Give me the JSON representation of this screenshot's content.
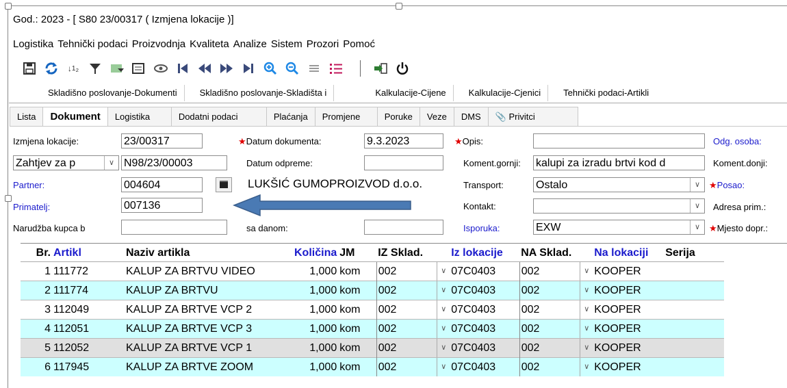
{
  "window": {
    "title": "God.: 2023 - [ S80 23/00317  ( Izmjena lokacije )]"
  },
  "menu": [
    "Logistika",
    "Tehnički podaci",
    "Proizvodnja",
    "Kvaliteta",
    "Analize",
    "Sistem",
    "Prozori",
    "Pomoć"
  ],
  "toolbar": {
    "icons": [
      "save-icon",
      "refresh-icon",
      "sort-icon",
      "filter-icon",
      "filter-table-icon",
      "preview-icon",
      "eye-icon",
      "first-icon",
      "prev-icon",
      "next-icon",
      "last-icon",
      "zoom-in-icon",
      "zoom-out-icon",
      "align-icon",
      "list-icon",
      "exit-icon",
      "power-icon"
    ]
  },
  "window_tabs": [
    "Skladišno poslovanje-Dokumenti",
    "Skladišno poslovanje-Skladišta i",
    "Kalkulacije-Cijene",
    "Kalkulacije-Cjenici",
    "Tehnički podaci-Artikli"
  ],
  "doc_tabs": [
    "Lista",
    "Dokument",
    "Logistika",
    "Dodatni podaci",
    "Plaćanja",
    "Promjene",
    "Poruke",
    "Veze",
    "DMS",
    "Privitci"
  ],
  "form": {
    "izmjena_label": "Izmjena lokacije:",
    "izmjena_value": "23/00317",
    "datum_dok_label": "Datum dokumenta:",
    "datum_dok_value": "9.3.2023",
    "opis_label": "Opis:",
    "odg_osoba_label": "Odg. osoba:",
    "zahtjev_select": "Zahtjev za p",
    "zahtjev_value": "N98/23/00003",
    "datum_odp_label": "Datum odpreme:",
    "koment_gornji_label": "Koment.gornji:",
    "koment_gornji_value": "kalupi za izradu brtvi kod d",
    "koment_donji_label": "Koment.donji:",
    "partner_label": "Partner:",
    "partner_value": "004604",
    "partner_name": "LUKŠIĆ GUMOPROIZVOD d.o.o.",
    "transport_label": "Transport:",
    "transport_value": "Ostalo",
    "posao_label": "Posao:",
    "primatelj_label": "Primatelj:",
    "primatelj_value": "007136",
    "kontakt_label": "Kontakt:",
    "adresa_label": "Adresa prim.:",
    "narudzba_label": "Narudžba kupca b",
    "sa_danom_label": "sa danom:",
    "isporuka_label": "Isporuka:",
    "isporuka_value": "EXW",
    "mjesto_label": "Mjesto dopr.:"
  },
  "grid": {
    "headers": {
      "br": "Br.",
      "artikl": "Artikl",
      "naziv": "Naziv artikla",
      "kolicina": "Količina",
      "jm": "JM",
      "iz_sklad": "IZ Sklad.",
      "iz_lok": "Iz lokacije",
      "na_sklad": "NA Sklad.",
      "na_lok": "Na lokaciji",
      "serija": "Serija"
    },
    "rows": [
      {
        "br": "1",
        "artikl": "111772",
        "naziv": "KALUP ZA BRTVU VIDEO",
        "kolicina": "1,000",
        "jm": "kom",
        "iz_sklad": "002",
        "iz_lok": "07C0403",
        "na_sklad": "002",
        "na_lok": "KOOPER"
      },
      {
        "br": "2",
        "artikl": "111774",
        "naziv": "KALUP ZA BRTVU",
        "kolicina": "1,000",
        "jm": "kom",
        "iz_sklad": "002",
        "iz_lok": "07C0403",
        "na_sklad": "002",
        "na_lok": "KOOPER"
      },
      {
        "br": "3",
        "artikl": "112049",
        "naziv": "KALUP ZA BRTVE VCP 2",
        "kolicina": "1,000",
        "jm": "kom",
        "iz_sklad": "002",
        "iz_lok": "07C0403",
        "na_sklad": "002",
        "na_lok": "KOOPER"
      },
      {
        "br": "4",
        "artikl": "112051",
        "naziv": "KALUP ZA BRTVE VCP 3",
        "kolicina": "1,000",
        "jm": "kom",
        "iz_sklad": "002",
        "iz_lok": "07C0403",
        "na_sklad": "002",
        "na_lok": "KOOPER"
      },
      {
        "br": "5",
        "artikl": "112052",
        "naziv": "KALUP ZA BRTVE VCP 1",
        "kolicina": "1,000",
        "jm": "kom",
        "iz_sklad": "002",
        "iz_lok": "07C0403",
        "na_sklad": "002",
        "na_lok": "KOOPER"
      },
      {
        "br": "6",
        "artikl": "117945",
        "naziv": "KALUP ZA BRTVE ZOOM",
        "kolicina": "1,000",
        "jm": "kom",
        "iz_sklad": "002",
        "iz_lok": "07C0403",
        "na_sklad": "002",
        "na_lok": "KOOPER"
      }
    ]
  },
  "colors": {
    "link_blue": "#1a1acc",
    "required_star": "#e00000",
    "row_alt": "#ccffff",
    "row_selected": "#e0e0e0",
    "arrow": "#4a7ab4"
  }
}
